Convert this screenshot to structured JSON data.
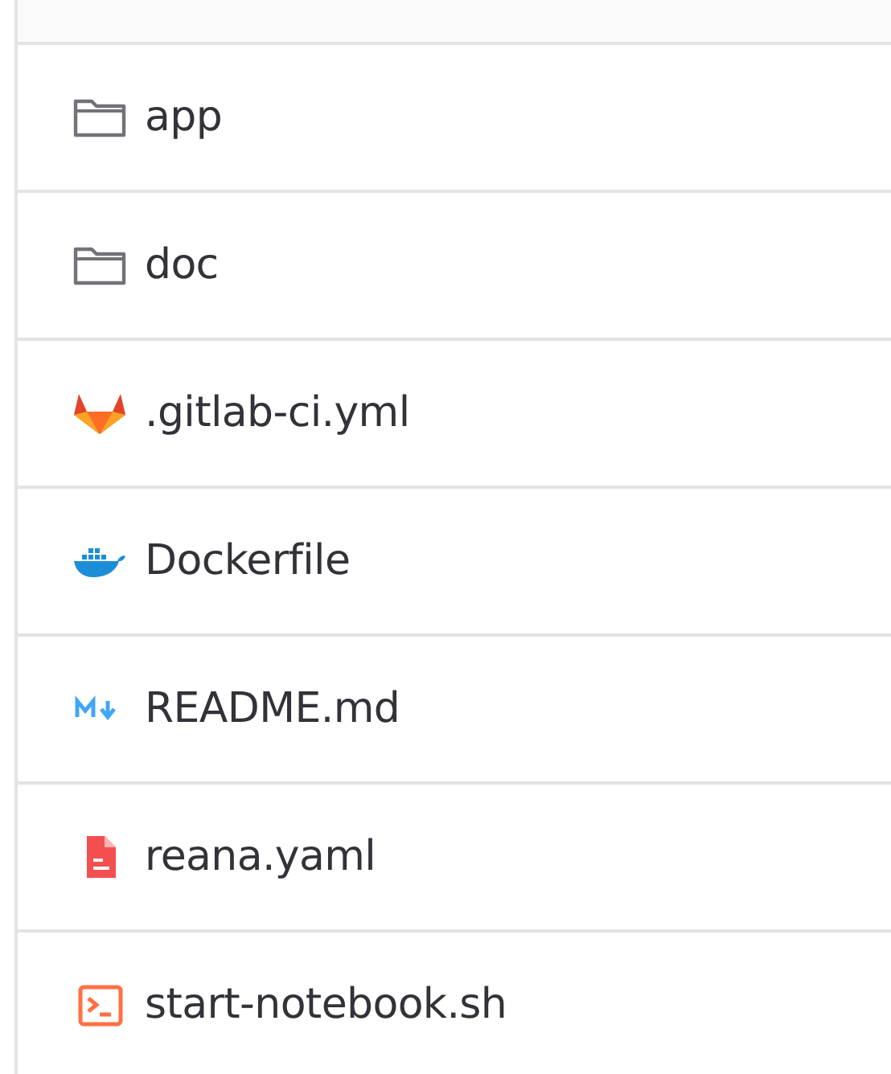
{
  "files": [
    {
      "name": "app",
      "kind": "folder"
    },
    {
      "name": "doc",
      "kind": "folder"
    },
    {
      "name": ".gitlab-ci.yml",
      "kind": "gitlab"
    },
    {
      "name": "Dockerfile",
      "kind": "docker"
    },
    {
      "name": "README.md",
      "kind": "markdown"
    },
    {
      "name": "reana.yaml",
      "kind": "yaml"
    },
    {
      "name": "start-notebook.sh",
      "kind": "shell"
    }
  ]
}
